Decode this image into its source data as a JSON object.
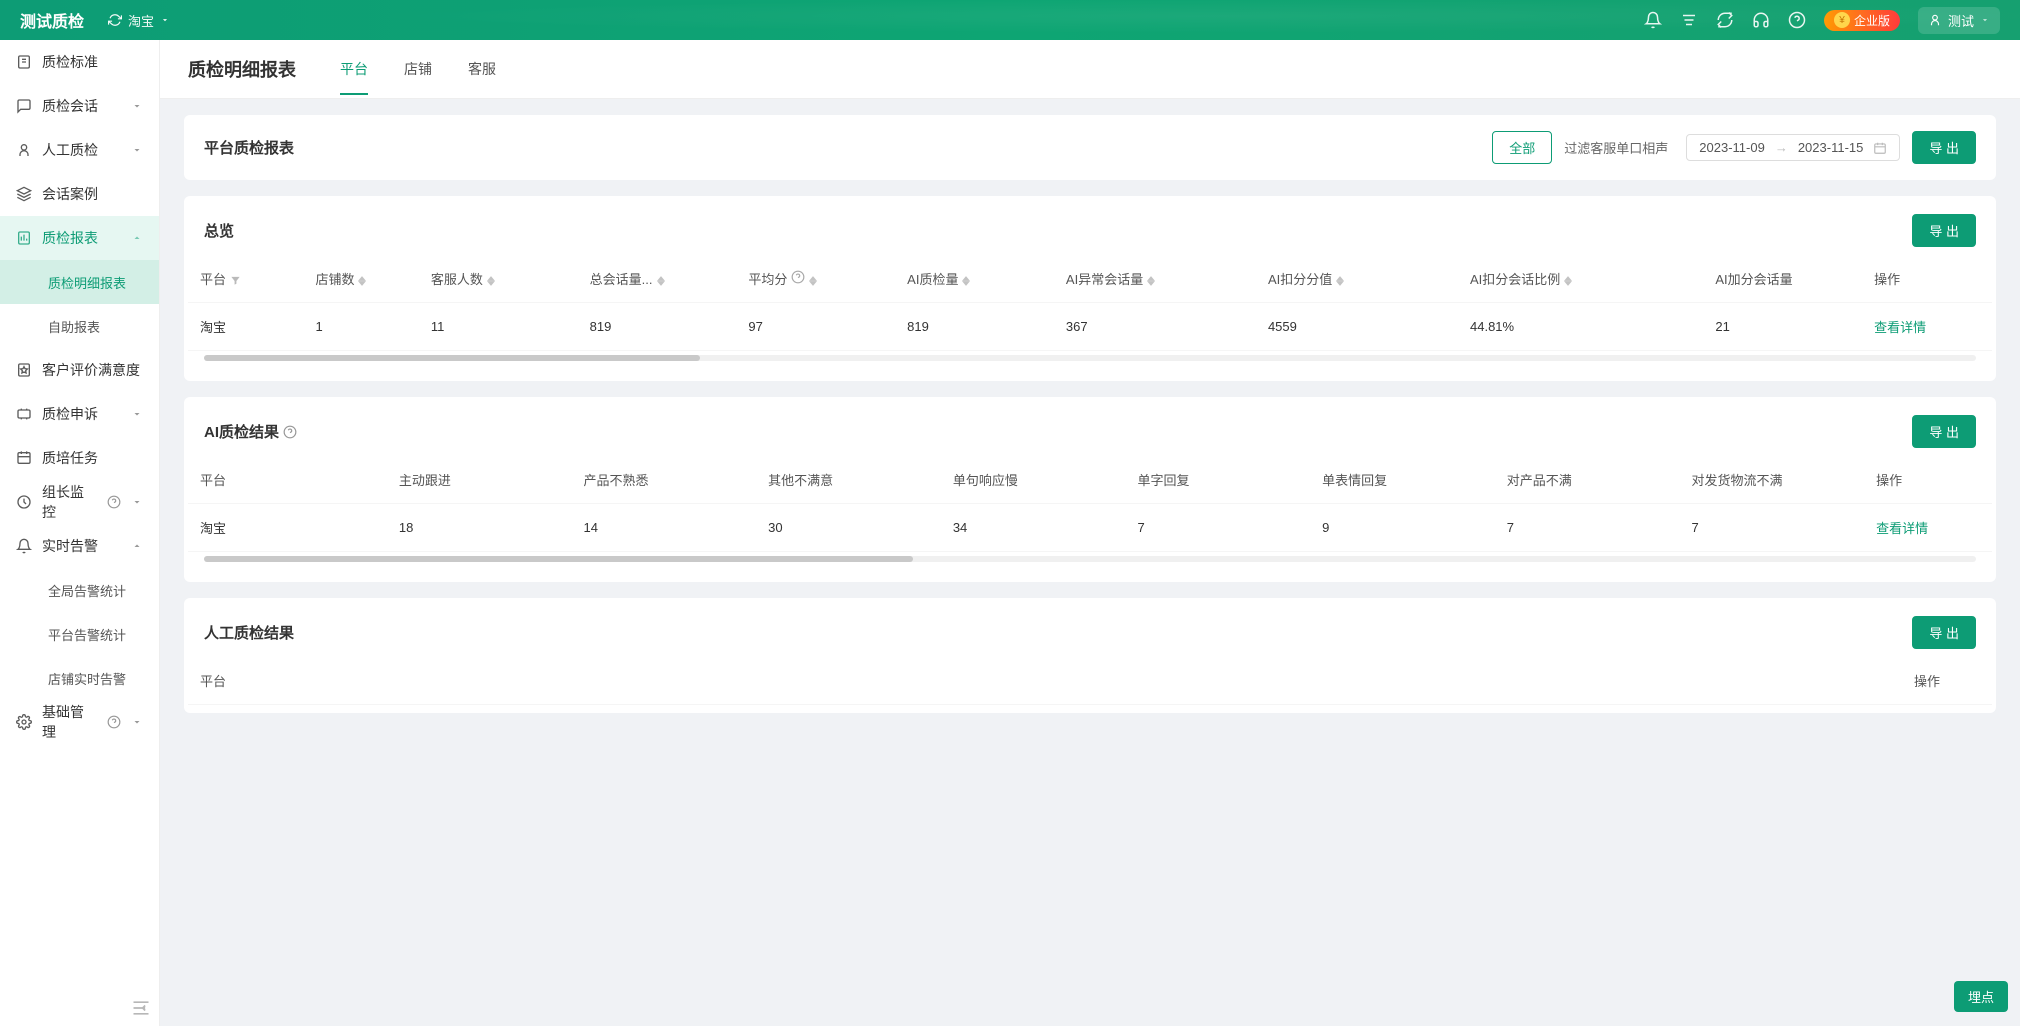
{
  "header": {
    "app_name": "测试质检",
    "platform_selected": "淘宝",
    "enterprise_label": "企业版",
    "user_name": "测试"
  },
  "sidebar": {
    "items": [
      {
        "icon": "standard",
        "label": "质检标准",
        "expandable": false
      },
      {
        "icon": "chat",
        "label": "质检会话",
        "expandable": true,
        "open": false
      },
      {
        "icon": "person",
        "label": "人工质检",
        "expandable": true,
        "open": false
      },
      {
        "icon": "layers",
        "label": "会话案例",
        "expandable": false
      },
      {
        "icon": "report",
        "label": "质检报表",
        "expandable": true,
        "open": true,
        "active": true,
        "children": [
          {
            "label": "质检明细报表",
            "active": true
          },
          {
            "label": "自助报表"
          }
        ]
      },
      {
        "icon": "star",
        "label": "客户评价满意度",
        "expandable": false
      },
      {
        "icon": "appeal",
        "label": "质检申诉",
        "expandable": true,
        "open": false
      },
      {
        "icon": "task",
        "label": "质培任务",
        "expandable": false
      },
      {
        "icon": "clock",
        "label": "组长监控",
        "expandable": true,
        "open": false,
        "help": true
      },
      {
        "icon": "bell",
        "label": "实时告警",
        "expandable": true,
        "open": true,
        "children": [
          {
            "label": "全局告警统计"
          },
          {
            "label": "平台告警统计"
          },
          {
            "label": "店铺实时告警"
          }
        ]
      },
      {
        "icon": "gear",
        "label": "基础管理",
        "expandable": true,
        "open": false,
        "help": true
      }
    ]
  },
  "page": {
    "title": "质检明细报表",
    "tabs": [
      {
        "label": "平台",
        "active": true
      },
      {
        "label": "店铺"
      },
      {
        "label": "客服"
      }
    ]
  },
  "filters": {
    "panel_title": "平台质检报表",
    "all_label": "全部",
    "filter_text": "过滤客服单口相声",
    "date_from": "2023-11-09",
    "date_to": "2023-11-15",
    "export_label": "导 出"
  },
  "overview": {
    "title": "总览",
    "export_label": "导 出",
    "columns": [
      "平台",
      "店铺数",
      "客服人数",
      "总会话量...",
      "平均分",
      "AI质检量",
      "AI异常会话量",
      "AI扣分分值",
      "AI扣分会话比例",
      "AI加分会话量",
      "操作"
    ],
    "row": {
      "platform": "淘宝",
      "store_count": "1",
      "agent_count": "11",
      "total_sessions": "819",
      "avg_score": "97",
      "ai_checked": "819",
      "ai_abnormal": "367",
      "ai_deduct_points": "4559",
      "ai_deduct_ratio": "44.81%",
      "ai_bonus_sessions": "21",
      "action": "查看详情"
    }
  },
  "ai_result": {
    "title": "AI质检结果",
    "export_label": "导 出",
    "columns": [
      "平台",
      "主动跟进",
      "产品不熟悉",
      "其他不满意",
      "单句响应慢",
      "单字回复",
      "单表情回复",
      "对产品不满",
      "对发货物流不满",
      "操作"
    ],
    "row": {
      "platform": "淘宝",
      "c1": "18",
      "c2": "14",
      "c3": "30",
      "c4": "34",
      "c5": "7",
      "c6": "9",
      "c7": "7",
      "c8": "7",
      "action": "查看详情"
    }
  },
  "manual_result": {
    "title": "人工质检结果",
    "export_label": "导 出",
    "columns": [
      "平台",
      "操作"
    ]
  },
  "float": {
    "label": "埋点"
  }
}
